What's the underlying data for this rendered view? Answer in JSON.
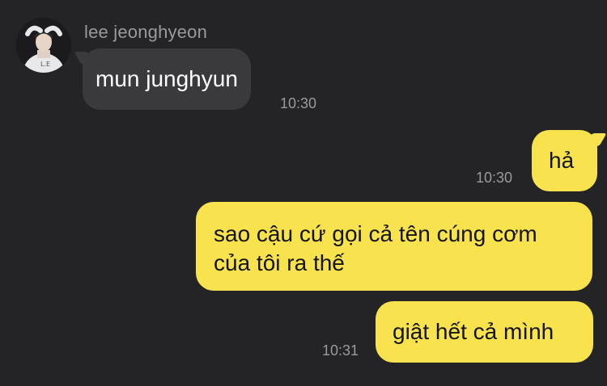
{
  "chat": {
    "contact_name": "lee jeonghyeon",
    "messages": [
      {
        "direction": "incoming",
        "text": "mun junghyun",
        "time": "10:30"
      },
      {
        "direction": "outgoing",
        "text": "hả",
        "time": "10:30"
      },
      {
        "direction": "outgoing",
        "text": "sao cậu cứ gọi cả tên cúng cơm\ncủa tôi ra thế",
        "time": ""
      },
      {
        "direction": "outgoing",
        "text": "giật hết cả mình",
        "time": "10:31"
      }
    ]
  },
  "colors": {
    "background": "#242426",
    "incoming_bubble": "#3a3a3c",
    "outgoing_bubble": "#f8e34f",
    "timestamp": "#9a9a9e"
  },
  "icons": {
    "avatar": "profile-photo"
  }
}
